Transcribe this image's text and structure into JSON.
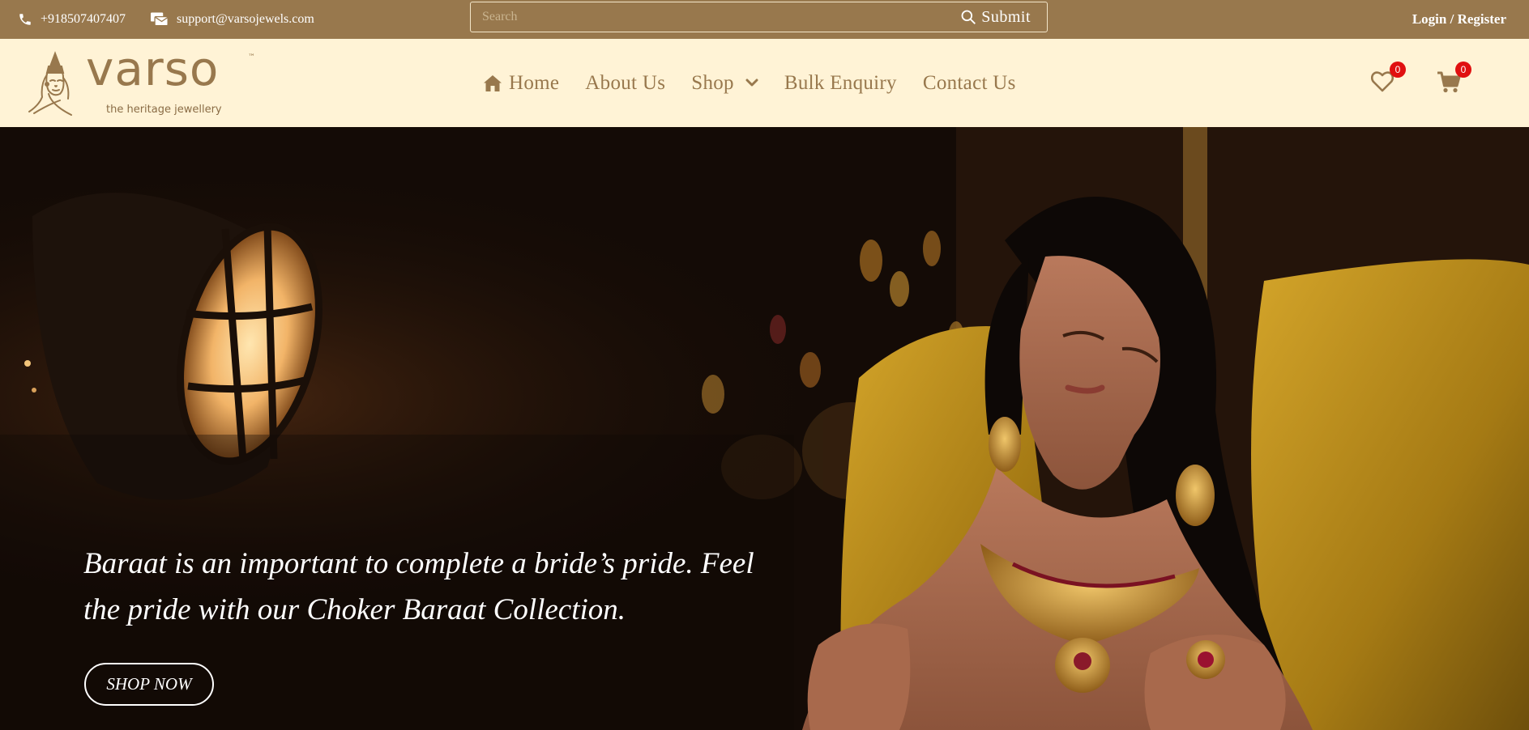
{
  "topbar": {
    "phone": "+918507407407",
    "email": "support@varsojewels.com",
    "search_placeholder": "Search",
    "submit_label": "Submit",
    "login_label": "Login / Register"
  },
  "brand": {
    "wordmark": "varso",
    "trademark": "™",
    "tagline": "the heritage jewellery"
  },
  "nav": {
    "home": "Home",
    "about": "About Us",
    "shop": "Shop",
    "bulk": "Bulk Enquiry",
    "contact": "Contact Us"
  },
  "header_icons": {
    "wishlist_count": "0",
    "cart_count": "0"
  },
  "hero": {
    "headline": "Baraat is an important to complete a bride’s pride. Feel the pride with our Choker Baraat Collection.",
    "cta_label": "SHOP NOW"
  },
  "colors": {
    "topbar_bg": "#98784d",
    "header_bg": "#fff3d6",
    "brand_gold": "#98784d",
    "badge_red": "#e01010"
  },
  "icons": [
    "phone-icon",
    "email-icon",
    "search-icon",
    "home-icon",
    "chevron-down-icon",
    "heart-icon",
    "cart-icon"
  ]
}
